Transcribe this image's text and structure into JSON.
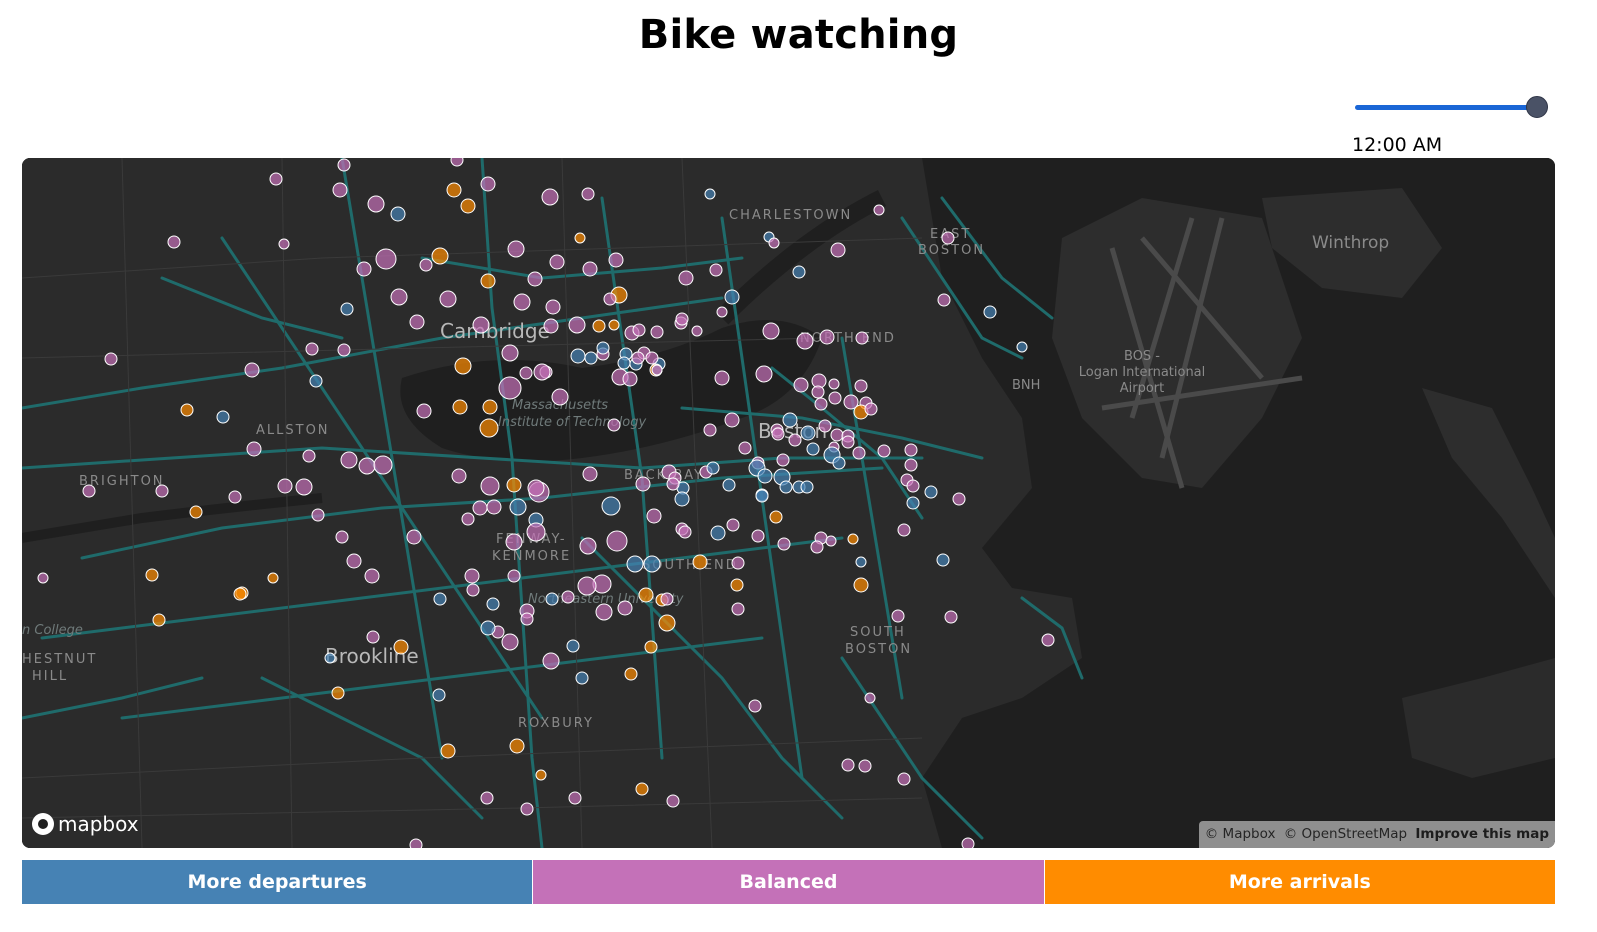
{
  "page": {
    "title": "Bike watching"
  },
  "time_filter": {
    "label": "12:00 AM",
    "level": 1.0
  },
  "legend": {
    "items": [
      {
        "label": "More departures",
        "color": "#4682b4"
      },
      {
        "label": "Balanced",
        "color": "#c471b8"
      },
      {
        "label": "More arrivals",
        "color": "#ff8c00"
      }
    ]
  },
  "map": {
    "theme": "dark",
    "logo_text": "mapbox",
    "attribution": {
      "mapbox": "© Mapbox",
      "osm": "© OpenStreetMap",
      "improve": "Improve this map"
    },
    "labels": {
      "winthrop": "Winthrop",
      "charlestown": "CHARLESTOWN",
      "east_boston": [
        "EAST",
        "BOSTON"
      ],
      "cambridge": "Cambridge",
      "north_end": "NORTH END",
      "bnh": "BNH",
      "airport": [
        "BOS -",
        "Logan International",
        "Airport"
      ],
      "mit": [
        "Massachusetts",
        "Institute of Technology"
      ],
      "allston": "ALLSTON",
      "boston": "Boston",
      "back_bay": "BACK BAY",
      "brighton": "BRIGHTON",
      "fenway": [
        "FENWAY-",
        "KENMORE"
      ],
      "south_end": "SOUTH END",
      "northeastern": "Northeastern University",
      "college": "n College",
      "south_boston": [
        "SOUTH",
        "BOSTON"
      ],
      "chestnut_hill": [
        "HESTNUT",
        "HILL"
      ],
      "brookline": "Brookline",
      "roxbury": "ROXBURY"
    }
  }
}
